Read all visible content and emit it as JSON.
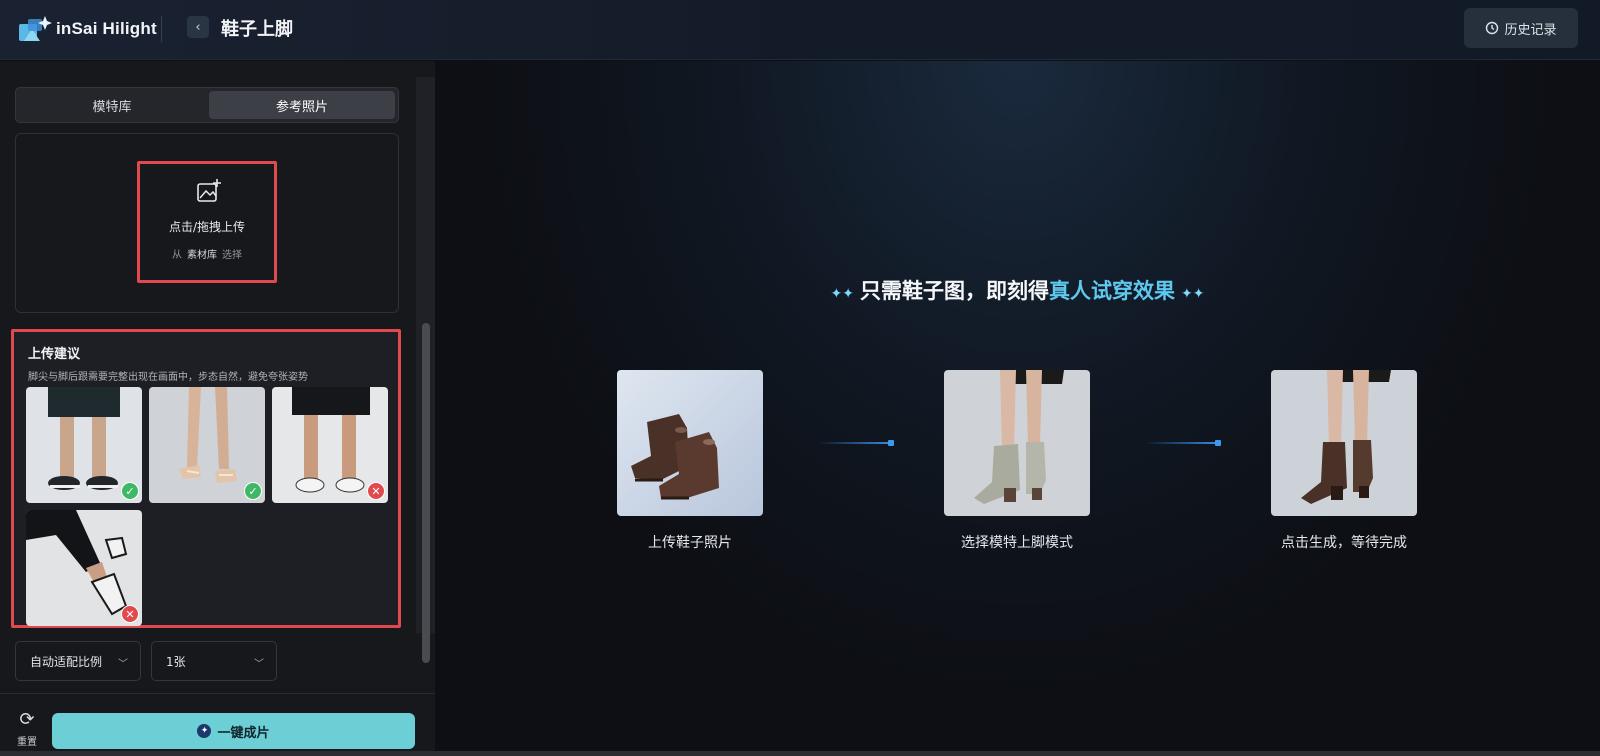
{
  "app": {
    "logo_text": "inSai Hilight",
    "page_title": "鞋子上脚",
    "history_label": "历史记录"
  },
  "colors": {
    "accent": "#6dcfd6",
    "highlight_text": "#5fc8ee",
    "annotation_red": "#e04a4f",
    "ok_green": "#3fb865"
  },
  "sidebar": {
    "tabs": [
      {
        "label": "模特库",
        "selected": false
      },
      {
        "label": "参考照片",
        "selected": true
      }
    ],
    "upload": {
      "label": "点击/拖拽上传",
      "sub_prefix": "从",
      "sub_library": "素材库",
      "sub_suffix": "选择",
      "icon": "image-add-icon"
    },
    "tips": {
      "title": "上传建议",
      "description": "脚尖与脚后跟需要完整出现在画面中，步态自然，避免夸张姿势",
      "samples": [
        {
          "name": "sample-sneakers-standing",
          "status": "ok"
        },
        {
          "name": "sample-sandals",
          "status": "ok"
        },
        {
          "name": "sample-shorts-sneakers",
          "status": "bad"
        },
        {
          "name": "sample-running-pose",
          "status": "bad"
        }
      ]
    },
    "ratio_select": {
      "value": "自动适配比例"
    },
    "count_select": {
      "value": "1张"
    },
    "reset_label": "重置",
    "generate_label": "一键成片"
  },
  "main": {
    "hero": {
      "prefix": "只需鞋子图，即刻得",
      "highlight": "真人试穿效果"
    },
    "steps": [
      {
        "caption": "上传鞋子照片"
      },
      {
        "caption": "选择模特上脚模式"
      },
      {
        "caption": "点击生成，等待完成"
      }
    ]
  }
}
